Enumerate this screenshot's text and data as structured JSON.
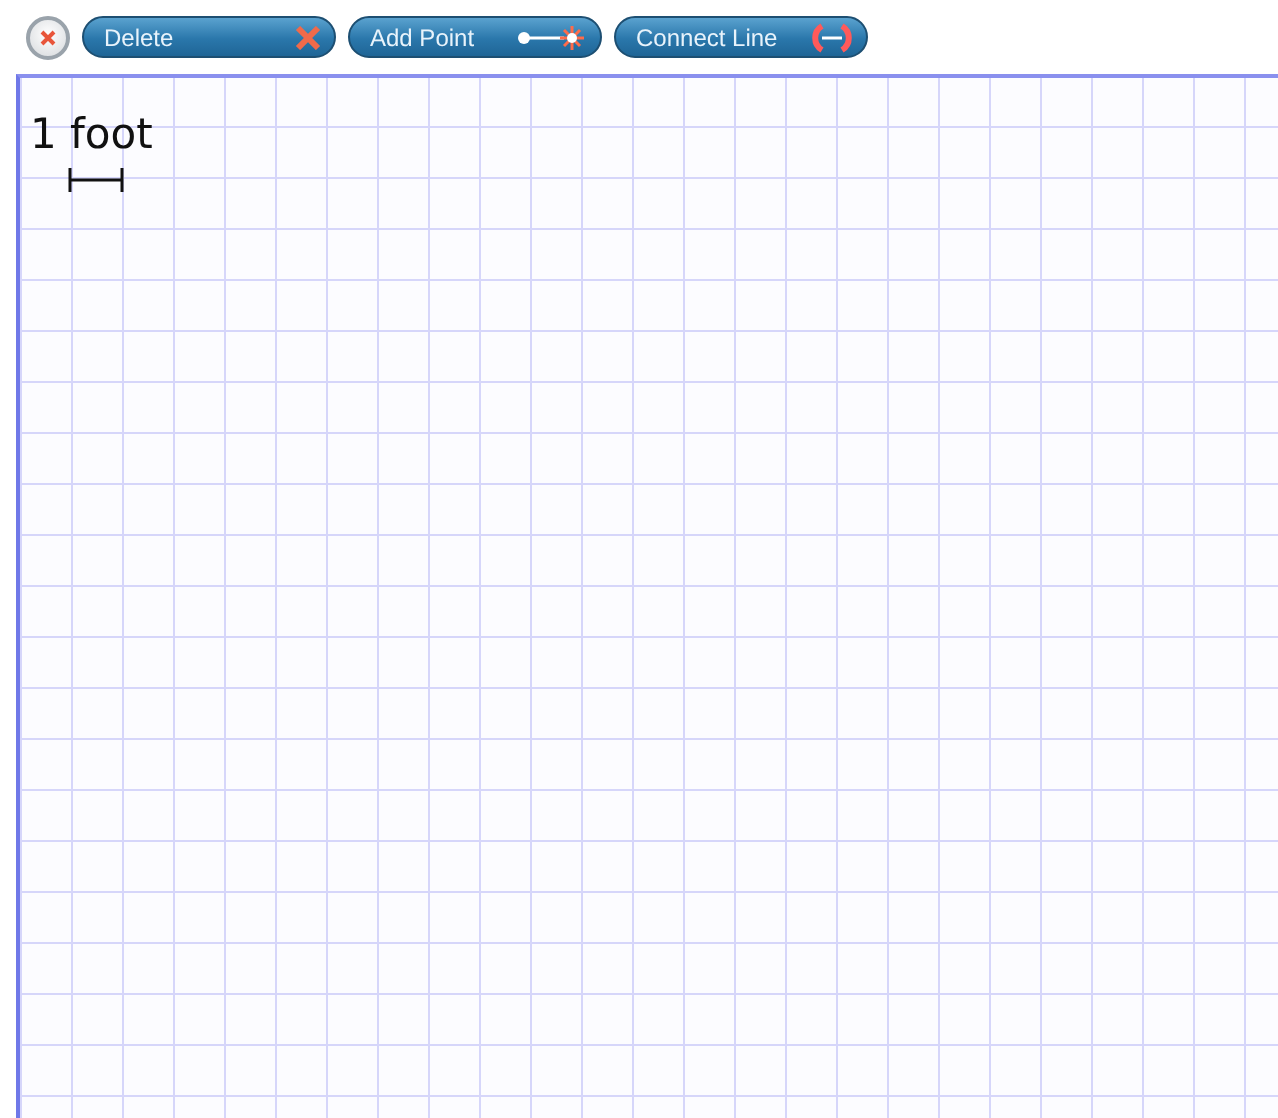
{
  "toolbar": {
    "buttons": [
      {
        "kind": "delete",
        "label": "Delete"
      },
      {
        "kind": "add-point",
        "label": "Add Point"
      },
      {
        "kind": "connect-line",
        "label": "Connect Line"
      }
    ]
  },
  "canvas": {
    "scale_label": "1 foot"
  }
}
